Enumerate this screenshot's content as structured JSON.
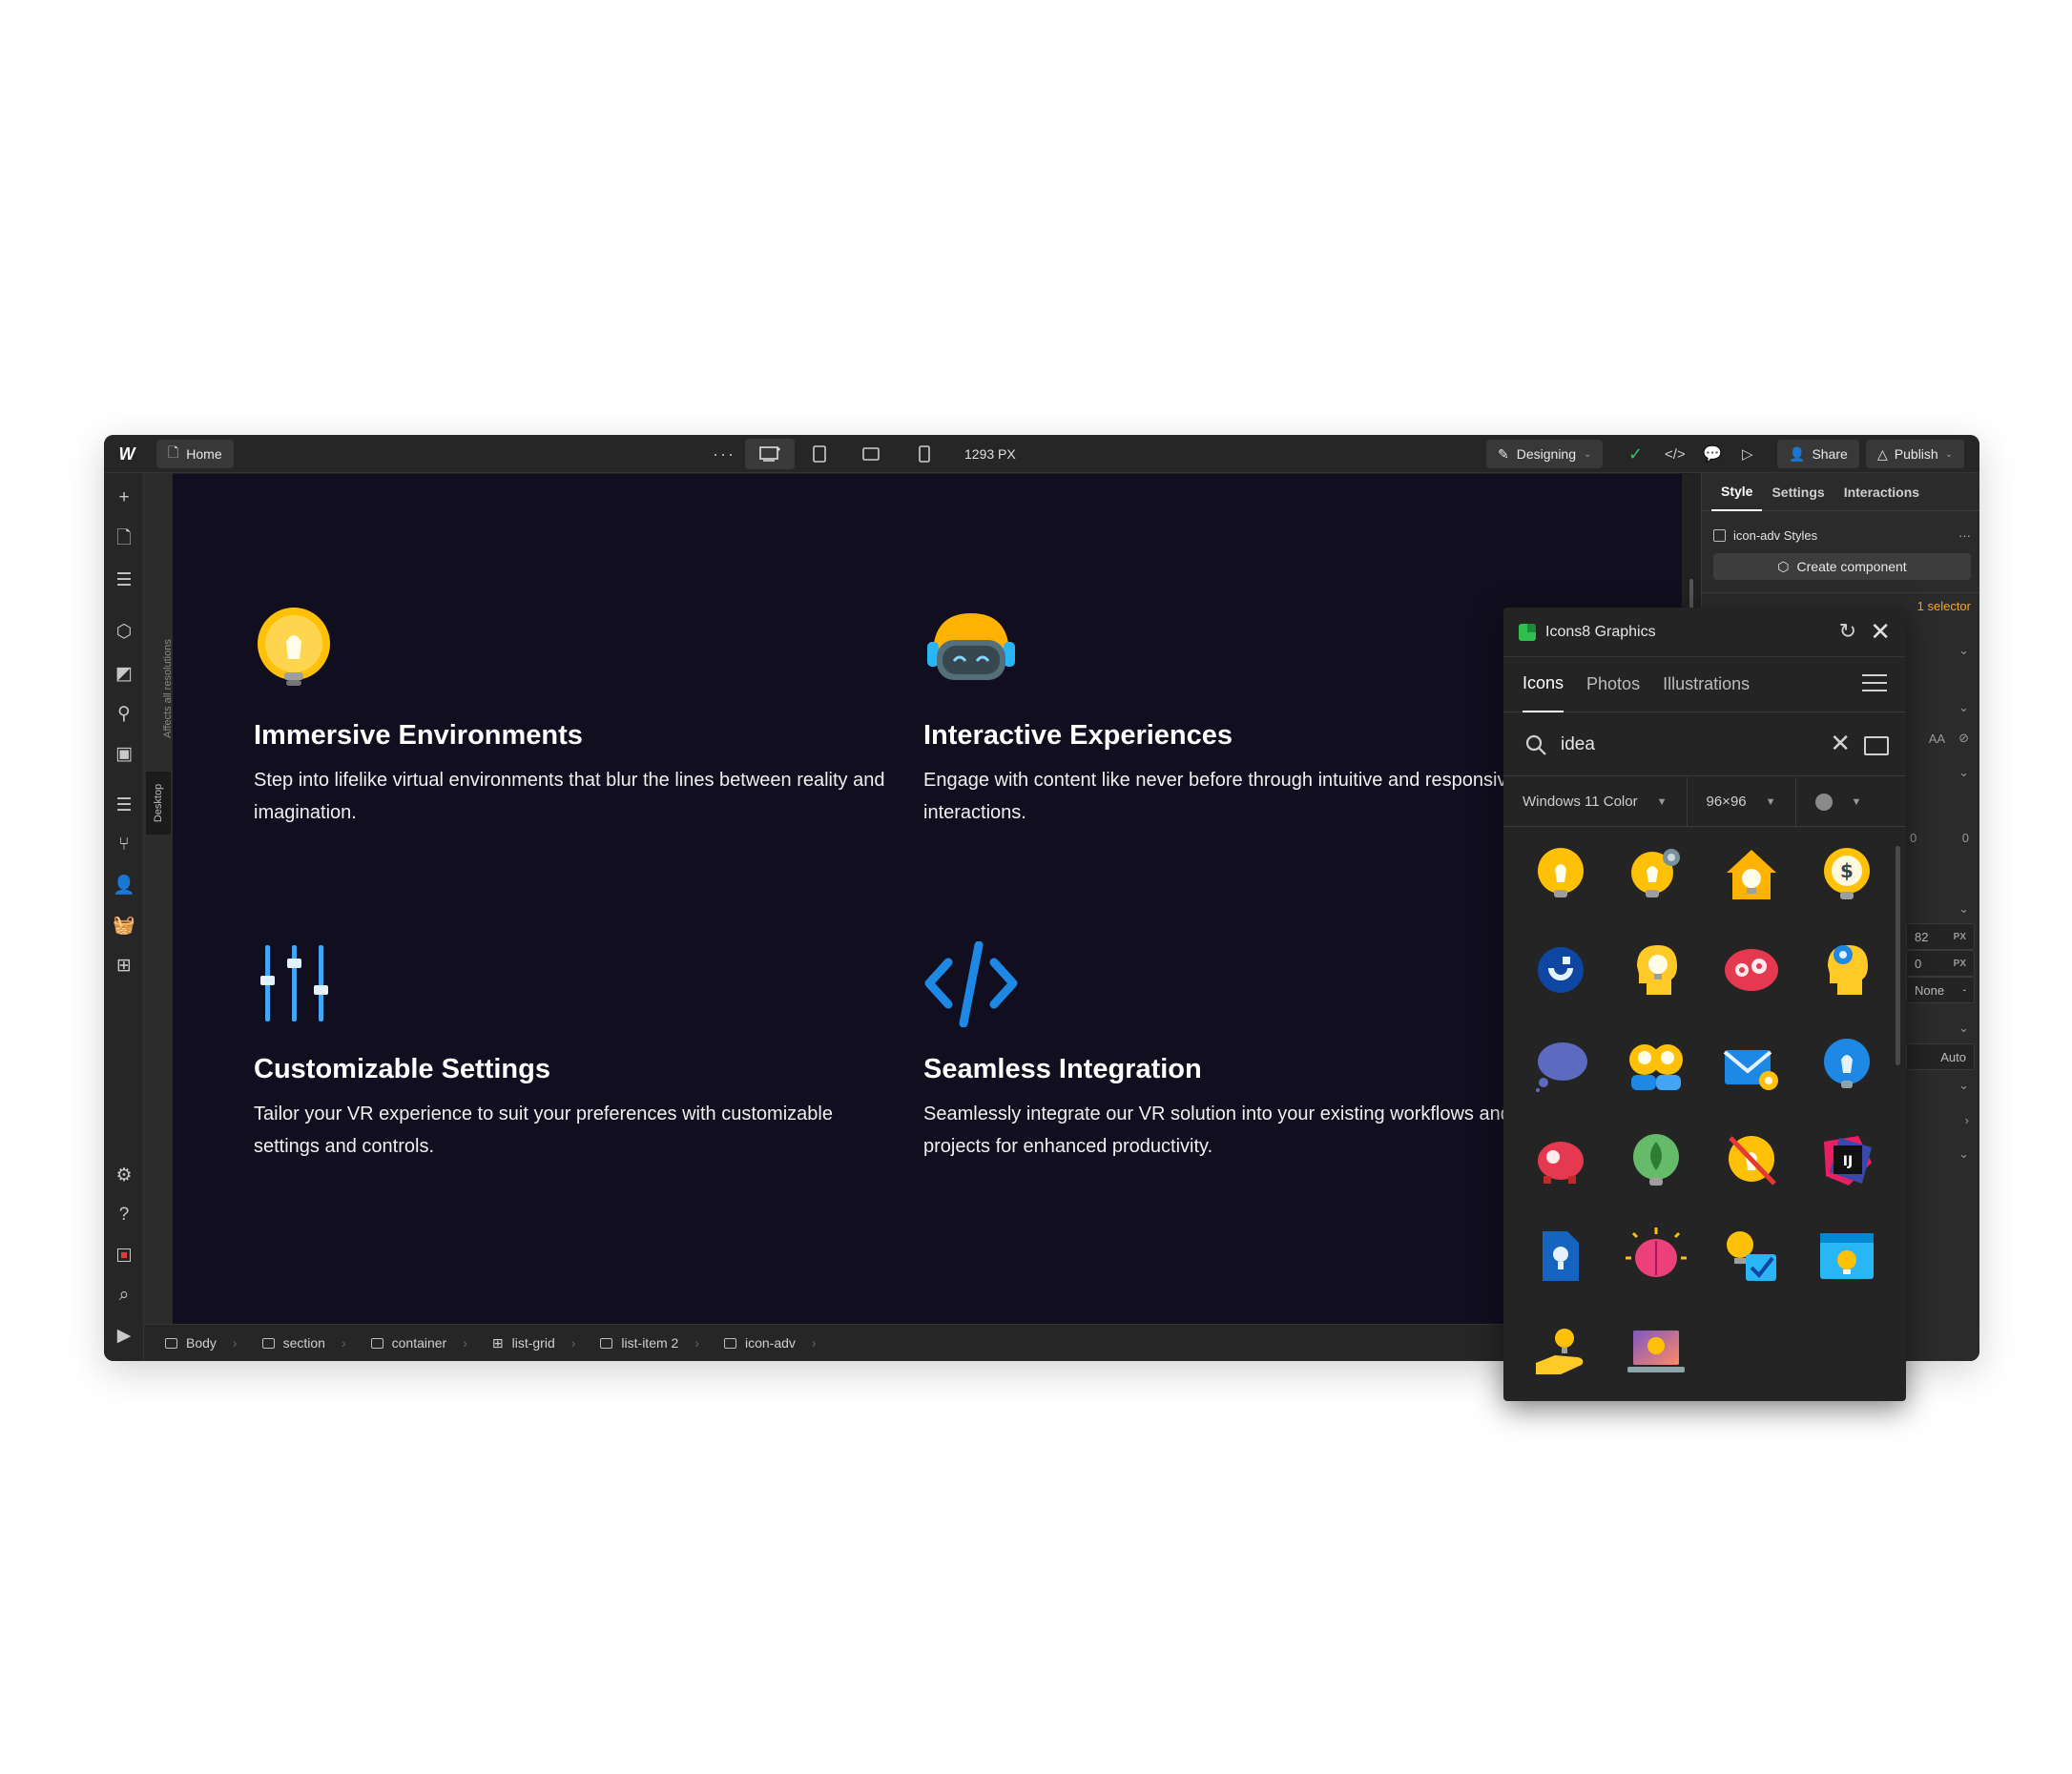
{
  "topbar": {
    "logo": "W",
    "page": "Home",
    "more": "···",
    "width_readout": "1293 PX",
    "mode": "Designing",
    "share": "Share",
    "publish": "Publish"
  },
  "left_strip": {
    "affects_text": "Affects all resolutions",
    "breakpoint_tag": "Desktop"
  },
  "features": [
    {
      "title": "Immersive Environments",
      "desc": "Step into lifelike virtual environments that blur the lines between reality and imagination.",
      "icon": "lightbulb-icon"
    },
    {
      "title": "Interactive Experiences",
      "desc": "Engage with content like never before through intuitive and responsive interactions.",
      "icon": "vr-headset-icon"
    },
    {
      "title": "Customizable Settings",
      "desc": "Tailor your VR experience to suit your preferences with customizable settings and controls.",
      "icon": "sliders-icon"
    },
    {
      "title": "Seamless Integration",
      "desc": "Seamlessly integrate our VR solution into your existing workflows and projects for enhanced productivity.",
      "icon": "code-icon"
    }
  ],
  "breadcrumbs": [
    "Body",
    "section",
    "container",
    "list-grid",
    "list-item 2",
    "icon-adv"
  ],
  "right_panel": {
    "tabs": [
      "Style",
      "Settings",
      "Interactions"
    ],
    "styles_label": "icon-adv Styles",
    "create_component": "Create component",
    "selector_note": "1 selector",
    "values": {
      "zero_a": "0",
      "zero_b": "0",
      "width": "82",
      "unit": "PX",
      "height": "0",
      "none": "None",
      "auto": "Auto",
      "aa": "AA"
    }
  },
  "icons8": {
    "title": "Icons8 Graphics",
    "tabs": [
      "Icons",
      "Photos",
      "Illustrations"
    ],
    "search_value": "idea",
    "style_filter": "Windows 11 Color",
    "size_filter": "96×96",
    "results": [
      "lightbulb",
      "lightbulb-gear",
      "house-idea",
      "dollar-idea",
      "magnet",
      "head-bulb",
      "brain-gears",
      "head-location",
      "thought-cloud",
      "two-heads",
      "mail-idea",
      "location-pin",
      "piggy-bank",
      "leaf-bulb",
      "no-idea",
      "intellij",
      "document-idea",
      "brain-spark",
      "idea-check",
      "browser-idea",
      "hand-idea",
      "laptop-idea"
    ]
  },
  "colors": {
    "canvas_bg": "#110f1f",
    "chrome_bg": "#262626",
    "accent_orange": "#f5a623",
    "bulb_yellow": "#ffc107",
    "code_blue": "#1e88e5"
  }
}
